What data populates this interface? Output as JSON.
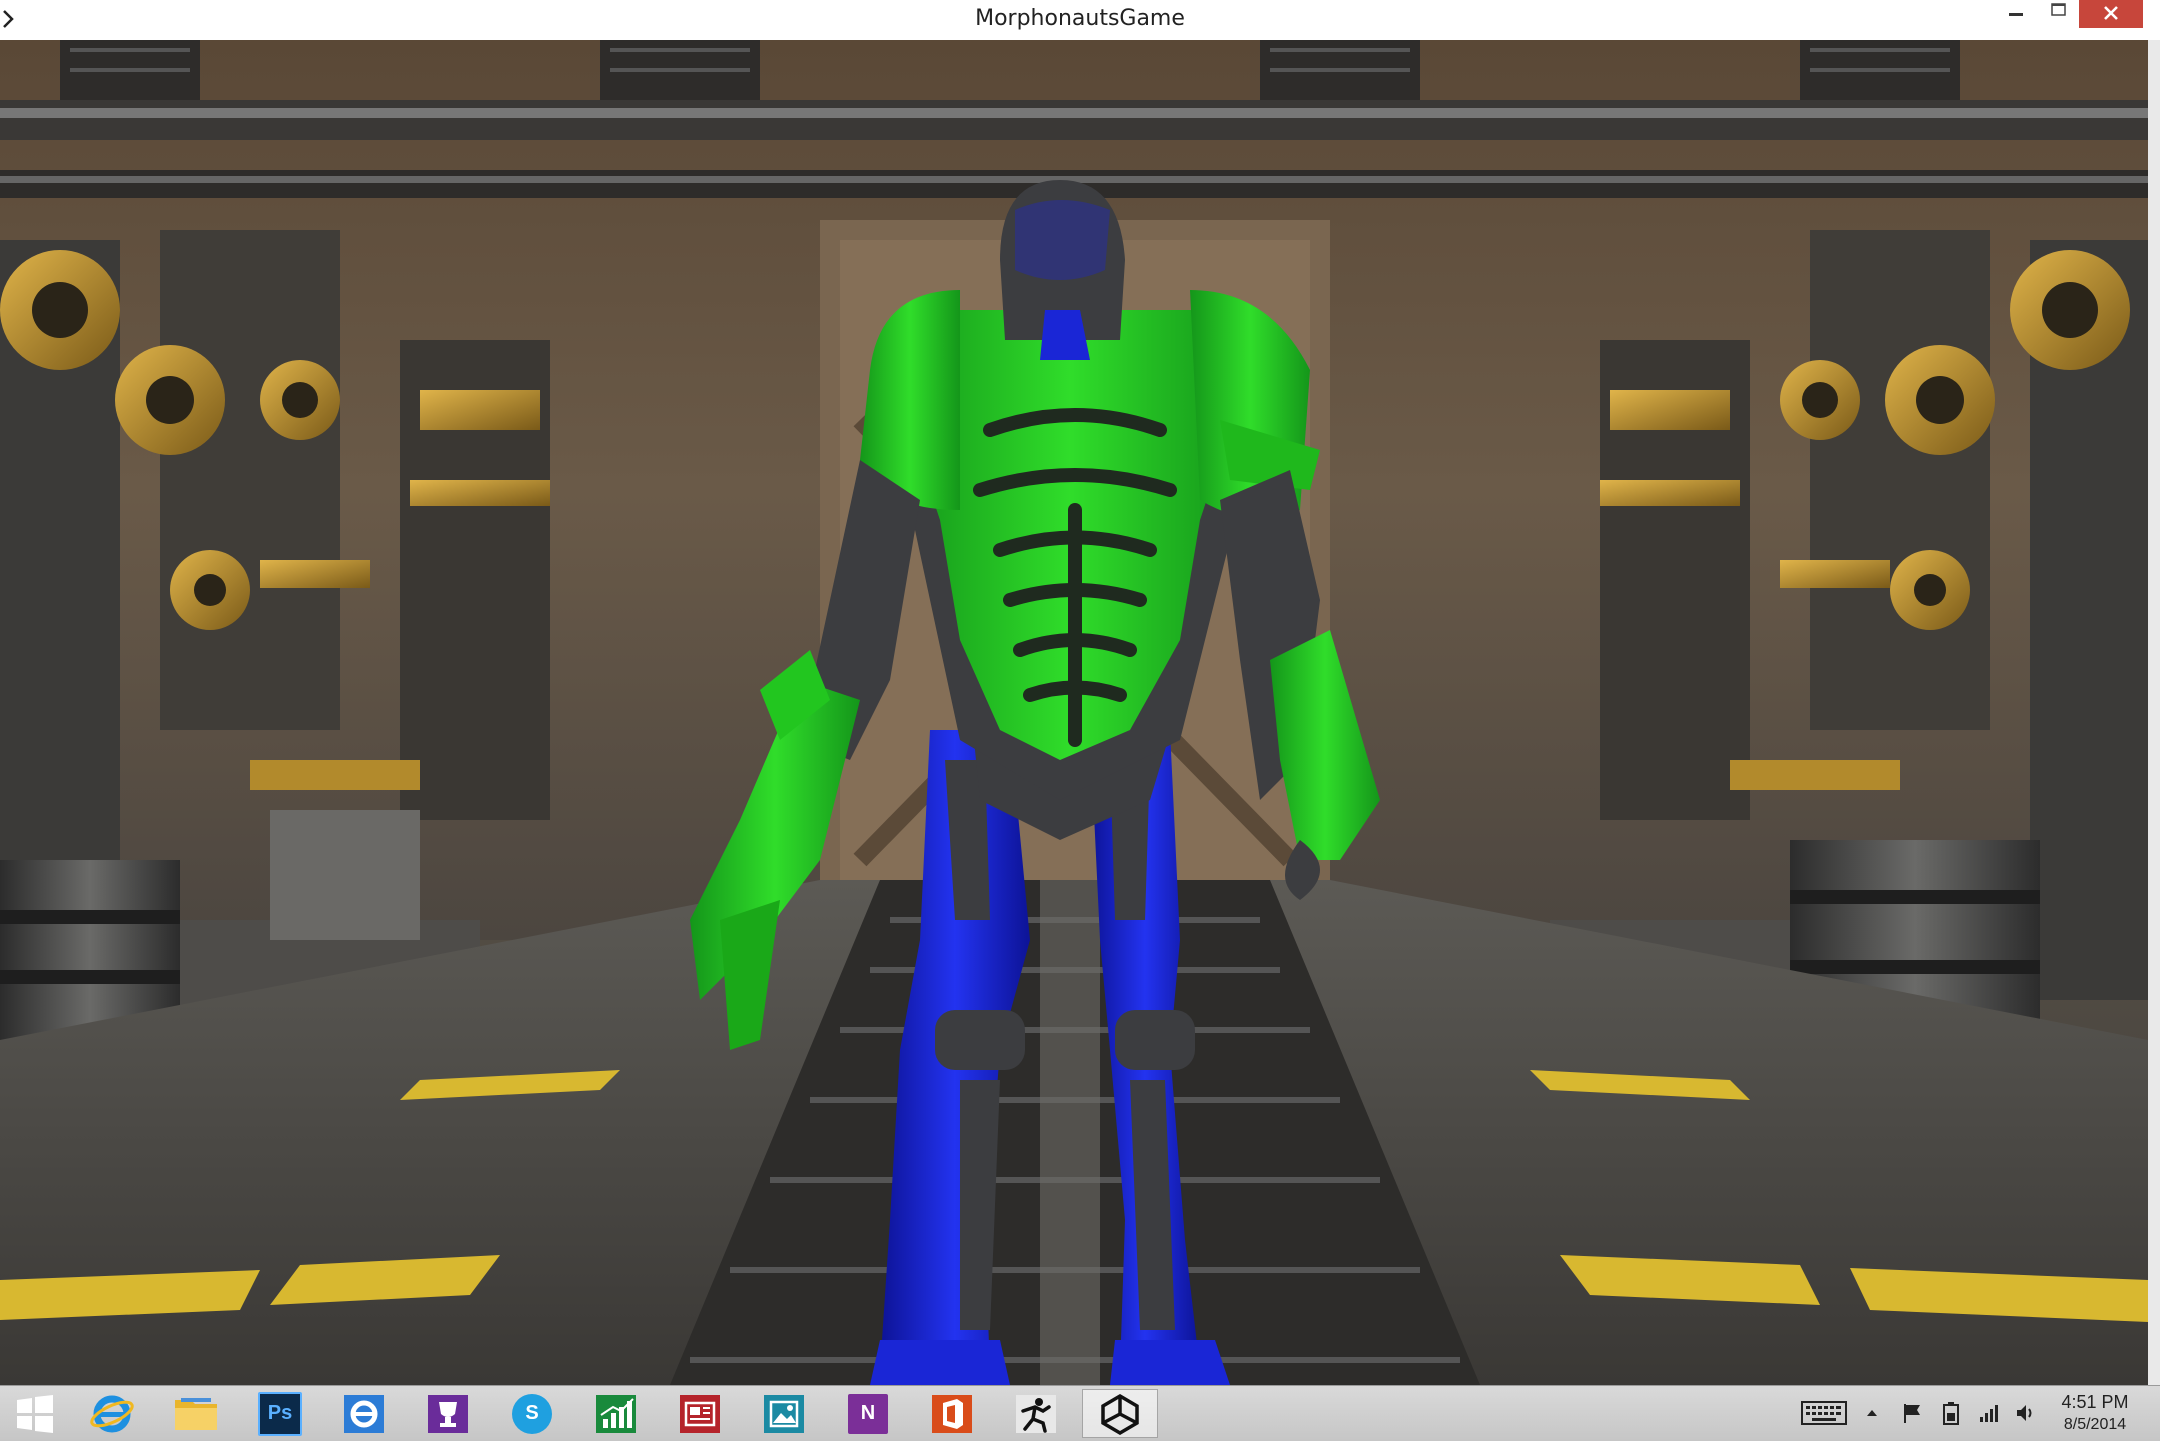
{
  "window": {
    "title": "MorphonautsGame"
  },
  "taskbar": {
    "pinned": [
      {
        "id": "start",
        "icon": "windows-start-icon"
      },
      {
        "id": "ie",
        "icon": "internet-explorer-icon",
        "color": "#1e90e0"
      },
      {
        "id": "explorer",
        "icon": "file-explorer-icon",
        "color": "#f2c23c"
      },
      {
        "id": "photoshop",
        "icon": "photoshop-icon",
        "label": "Ps",
        "color": "#0b2a4a"
      },
      {
        "id": "ie-dev",
        "icon": "internet-explorer-icon",
        "color": "#2c7cd6"
      },
      {
        "id": "trophy",
        "icon": "trophy-icon",
        "color": "#6a2c9a"
      },
      {
        "id": "skype",
        "icon": "skype-icon",
        "label": "S",
        "color": "#1fa0e0"
      },
      {
        "id": "finance",
        "icon": "finance-chart-icon",
        "color": "#198a3c"
      },
      {
        "id": "news",
        "icon": "news-icon",
        "color": "#b5242b"
      },
      {
        "id": "photos",
        "icon": "photos-icon",
        "color": "#1b8aa3"
      },
      {
        "id": "onenote",
        "icon": "onenote-icon",
        "label": "N",
        "color": "#7b2f98"
      },
      {
        "id": "office",
        "icon": "office-icon",
        "color": "#d94c1a"
      },
      {
        "id": "zbrush",
        "icon": "running-figure-icon",
        "color": "#e8e8e8"
      },
      {
        "id": "unity",
        "icon": "unity-icon",
        "color": "#ffffff"
      }
    ],
    "tray": {
      "icons": [
        "keyboard-icon",
        "chevron-up-icon",
        "flag-icon",
        "battery-icon",
        "signal-icon",
        "volume-icon"
      ],
      "time": "4:51 PM",
      "date": "8/5/2014"
    }
  },
  "colors": {
    "robot_green": "#22c61f",
    "robot_blue": "#1a26d6",
    "robot_gray": "#3c3d40",
    "machinery_gold": "#b28a2c",
    "hazard_yellow": "#d8b830"
  }
}
